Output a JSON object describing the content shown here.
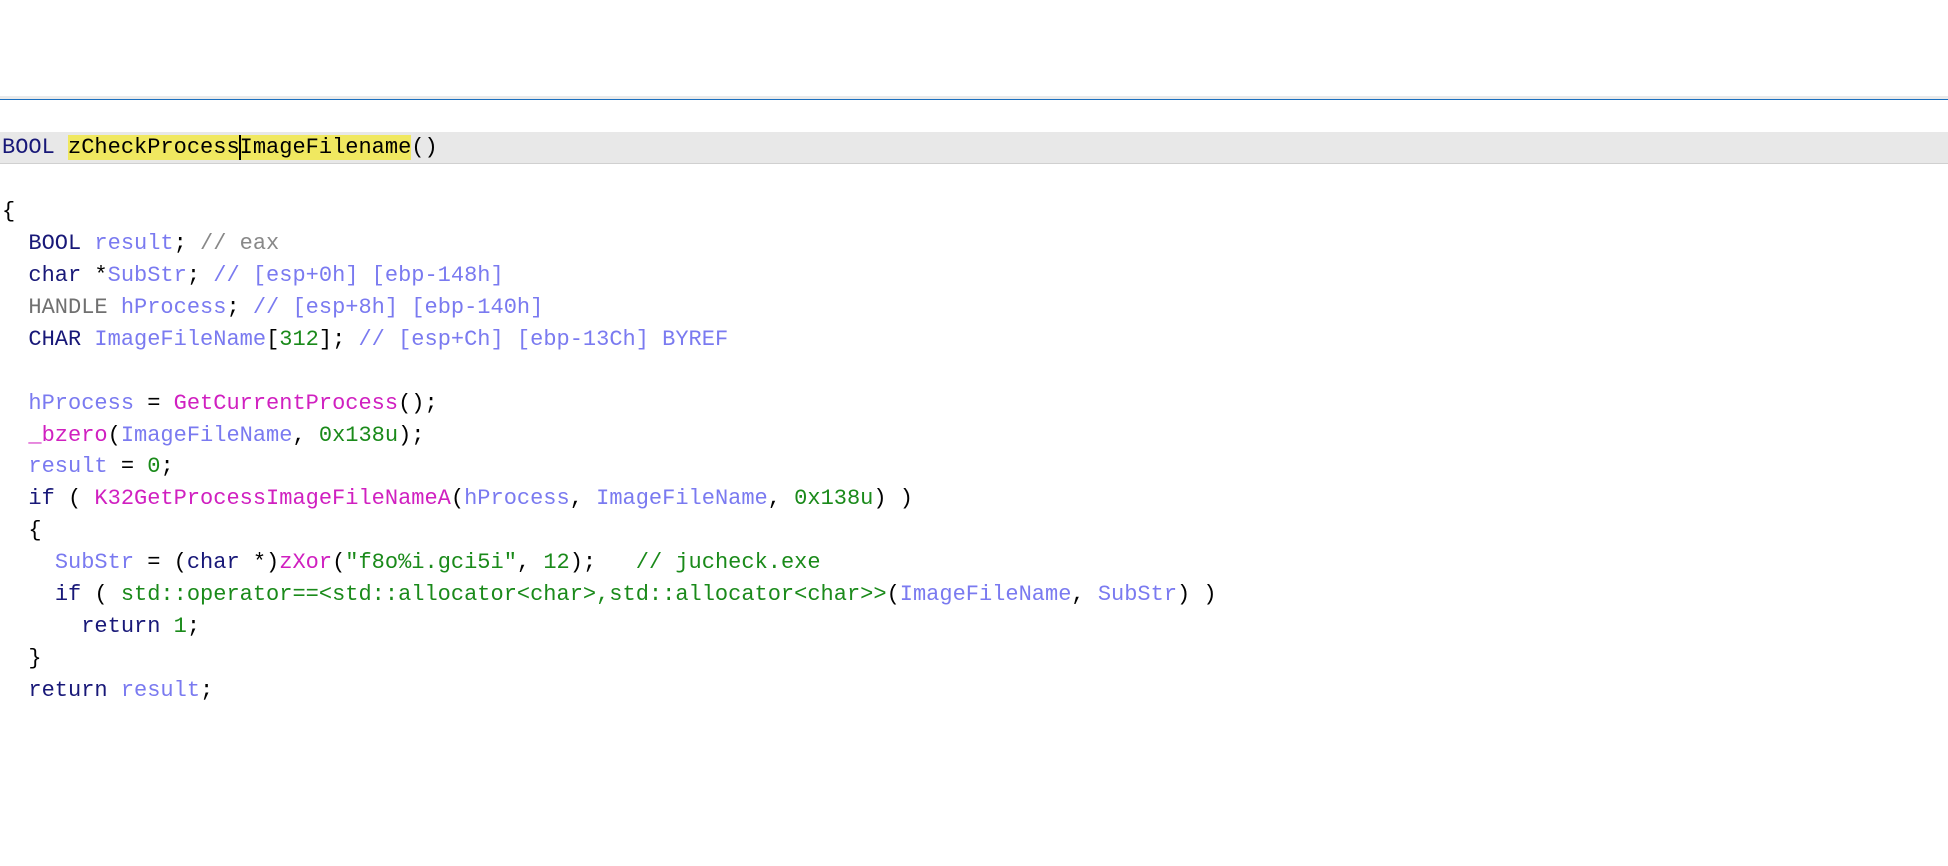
{
  "sig": {
    "ret": "BOOL",
    "name1": "zCheckProcess",
    "name2": "ImageFilename",
    "parens": "()"
  },
  "l1": {
    "brace": "{"
  },
  "l2": {
    "ind": "  ",
    "kw": "BOOL",
    "sp": " ",
    "var": "result",
    "rest": "; ",
    "cmt": "// eax"
  },
  "l3": {
    "ind": "  ",
    "kw": "char",
    "star": " *",
    "var": "SubStr",
    "rest": "; ",
    "cmt": "// [esp+0h] [ebp-148h]"
  },
  "l4": {
    "ind": "  ",
    "kw": "HANDLE",
    "sp": " ",
    "var": "hProcess",
    "rest": "; ",
    "cmt": "// [esp+8h] [ebp-140h]"
  },
  "l5": {
    "ind": "  ",
    "kw": "CHAR",
    "sp": " ",
    "var": "ImageFileName",
    "arr": "[",
    "num": "312",
    "arr2": "]; ",
    "cmt": "// [esp+Ch] [ebp-13Ch] BYREF"
  },
  "l6": {
    "blank": " "
  },
  "l7": {
    "ind": "  ",
    "var": "hProcess",
    "eq": " = ",
    "fn": "GetCurrentProcess",
    "rest": "();"
  },
  "l8": {
    "ind": "  ",
    "fn": "_bzero",
    "p1": "(",
    "var": "ImageFileName",
    "c": ", ",
    "num": "0x138u",
    "p2": ");"
  },
  "l9": {
    "ind": "  ",
    "var": "result",
    "eq": " = ",
    "num": "0",
    "semi": ";"
  },
  "l10": {
    "ind": "  ",
    "kw": "if",
    "sp": " ( ",
    "fn": "K32GetProcessImageFileNameA",
    "p1": "(",
    "a1": "hProcess",
    "c1": ", ",
    "a2": "ImageFileName",
    "c2": ", ",
    "num": "0x138u",
    "p2": ") )"
  },
  "l11": {
    "ind": "  ",
    "brace": "{"
  },
  "l12": {
    "ind": "    ",
    "var": "SubStr",
    "eq": " = (",
    "kw": "char",
    "cast": " *)",
    "fn": "zXor",
    "p1": "(",
    "str": "\"f8o%i.gci5i\"",
    "c": ", ",
    "num": "12",
    "p2": ");   ",
    "cmt": "// jucheck.exe"
  },
  "l13": {
    "ind": "    ",
    "kw": "if",
    "sp": " ( ",
    "ns": "std::operator==<std::allocator<char>,std::allocator<char>>",
    "p1": "(",
    "a1": "ImageFileName",
    "c1": ", ",
    "a2": "SubStr",
    "p2": ") )"
  },
  "l14": {
    "ind": "      ",
    "kw": "return",
    "sp": " ",
    "num": "1",
    "semi": ";"
  },
  "l15": {
    "ind": "  ",
    "brace": "}"
  },
  "l16": {
    "ind": "  ",
    "kw": "return",
    "sp": " ",
    "var": "result",
    "semi": ";"
  }
}
